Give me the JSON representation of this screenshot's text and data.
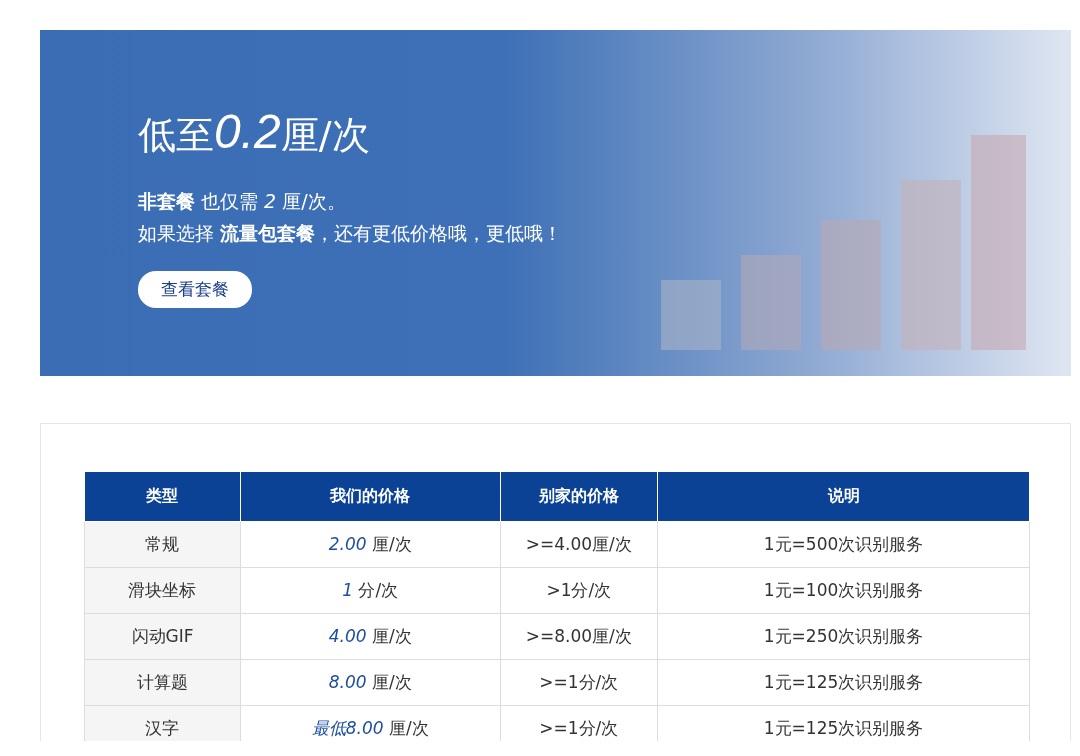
{
  "banner": {
    "headline": {
      "prefix": "低至",
      "figure": "0.2",
      "suffix": "厘/次"
    },
    "line_1": "**非套餐** 也仅需 *2* 厘/次。",
    "line_2": "如果选择 **流量包套餐**，还有更低价格哦，更低哦！",
    "button": "查看套餐"
  },
  "table": {
    "columns": [
      "类型",
      "我们的价格",
      "别家的价格",
      "说明"
    ],
    "rows": [
      {
        "type": "常规",
        "our_price": "*2.00* 厘/次",
        "other_price": ">=4.00厘/次",
        "note": "1元=500次识别服务"
      },
      {
        "type": "滑块坐标",
        "our_price": "*1* 分/次",
        "other_price": ">1分/次",
        "note": "1元=100次识别服务"
      },
      {
        "type": "闪动GIF",
        "our_price": "*4.00* 厘/次",
        "other_price": ">=8.00厘/次",
        "note": "1元=250次识别服务"
      },
      {
        "type": "计算题",
        "our_price": "*8.00* 厘/次",
        "other_price": ">=1分/次",
        "note": "1元=125次识别服务"
      },
      {
        "type": "汉字",
        "our_price": "*最低8.00* 厘/次",
        "other_price": ">=1分/次",
        "note": "1元=125次识别服务"
      }
    ]
  }
}
